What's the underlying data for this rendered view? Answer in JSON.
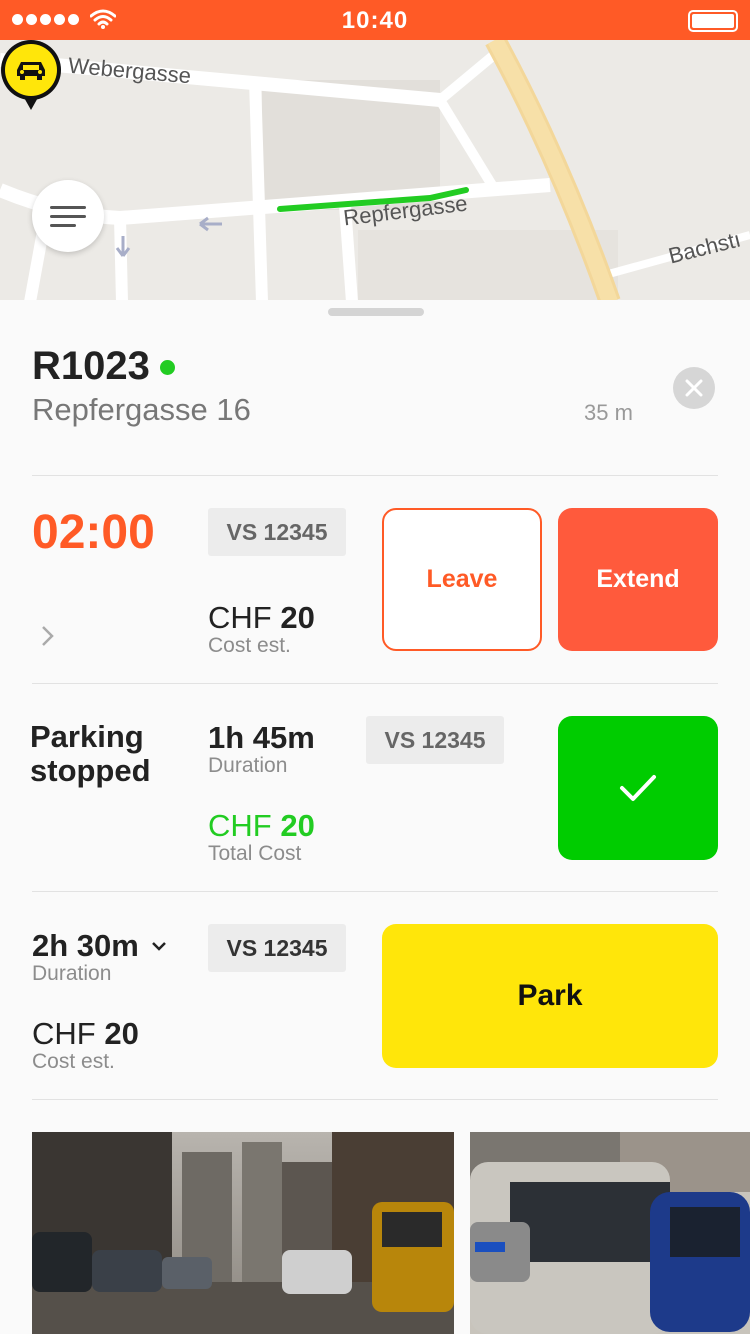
{
  "status_bar": {
    "time": "10:40"
  },
  "map": {
    "streets": [
      "Webergasse",
      "Repfergasse",
      "Bachstı"
    ]
  },
  "spot": {
    "id": "R1023",
    "address": "Repfergasse 16",
    "distance": "35 m",
    "status_color": "#22cc22"
  },
  "active_session": {
    "timer": "02:00",
    "plate": "VS 12345",
    "currency": "CHF",
    "cost": "20",
    "cost_label": "Cost est.",
    "leave_label": "Leave",
    "extend_label": "Extend"
  },
  "stopped_session": {
    "title": "Parking stopped",
    "duration": "1h 45m",
    "duration_label": "Duration",
    "plate": "VS 12345",
    "currency": "CHF",
    "cost": "20",
    "cost_label": "Total Cost"
  },
  "new_session": {
    "duration": "2h 30m",
    "duration_label": "Duration",
    "plate": "VS 12345",
    "currency": "CHF",
    "cost": "20",
    "cost_label": "Cost est.",
    "park_label": "Park"
  },
  "colors": {
    "accent": "#ff5a26",
    "success": "#00cc00",
    "park": "#ffe60a"
  },
  "icons": [
    "signal-icon",
    "wifi-icon",
    "battery-icon",
    "menu-icon",
    "car-pin-icon",
    "close-icon",
    "chevron-right-icon",
    "checkmark-icon",
    "chevron-down-icon"
  ]
}
